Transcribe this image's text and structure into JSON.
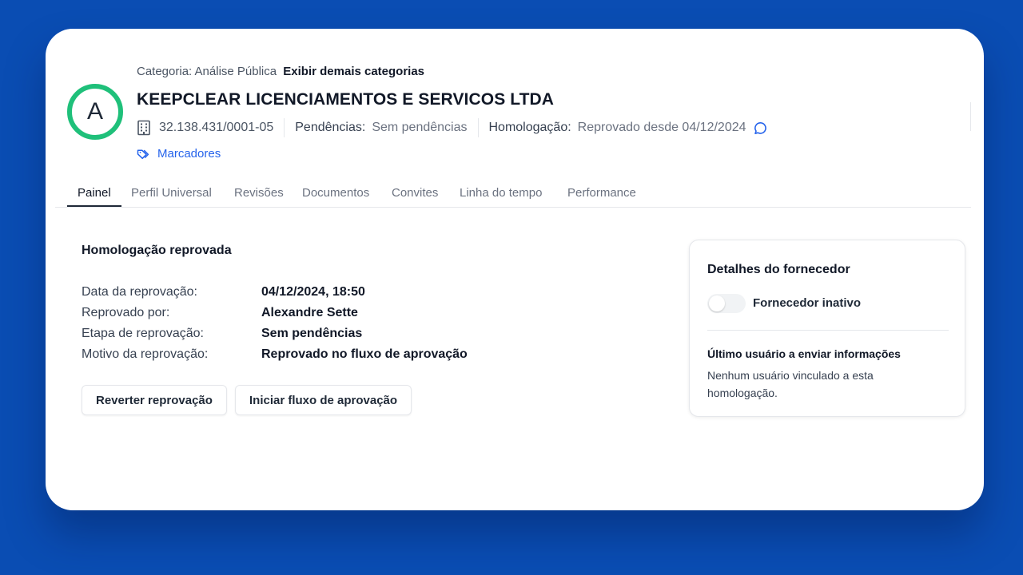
{
  "header": {
    "avatar_letter": "A",
    "category_label": "Categoria: Análise Pública",
    "category_link": "Exibir demais categorias",
    "company_name": "KEEPCLEAR LICENCIAMENTOS E SERVICOS LTDA",
    "cnpj": "32.138.431/0001-05",
    "pendencias_label": "Pendências:",
    "pendencias_value": "Sem pendências",
    "homologacao_label": "Homologação:",
    "homologacao_value": "Reprovado desde 04/12/2024",
    "markers_label": "Marcadores",
    "avatar_ring_color": "#1fc07a",
    "link_color": "#2563eb"
  },
  "tabs": [
    {
      "label": "Painel",
      "active": true
    },
    {
      "label": "Perfil Universal",
      "active": false
    },
    {
      "label": "Revisões",
      "active": false
    },
    {
      "label": "Documentos",
      "active": false
    },
    {
      "label": "Convites",
      "active": false
    },
    {
      "label": "Linha do tempo",
      "active": false
    },
    {
      "label": "Performance",
      "active": false
    }
  ],
  "main": {
    "title": "Homologação reprovada",
    "details": [
      {
        "label": "Data da reprovação:",
        "value": "04/12/2024, 18:50"
      },
      {
        "label": "Reprovado por:",
        "value": "Alexandre Sette"
      },
      {
        "label": "Etapa de reprovação:",
        "value": "Sem pendências"
      },
      {
        "label": "Motivo da reprovação:",
        "value": "Reprovado no fluxo de aprovação"
      }
    ],
    "buttons": {
      "revert": "Reverter reprovação",
      "start_flow": "Iniciar fluxo de aprovação"
    }
  },
  "panel": {
    "title": "Detalhes do fornecedor",
    "toggle_label": "Fornecedor inativo",
    "toggle_on": false,
    "subtitle": "Último usuário a enviar informações",
    "text": "Nenhum usuário vinculado a esta homologação."
  },
  "background_color": "#0a4db3"
}
